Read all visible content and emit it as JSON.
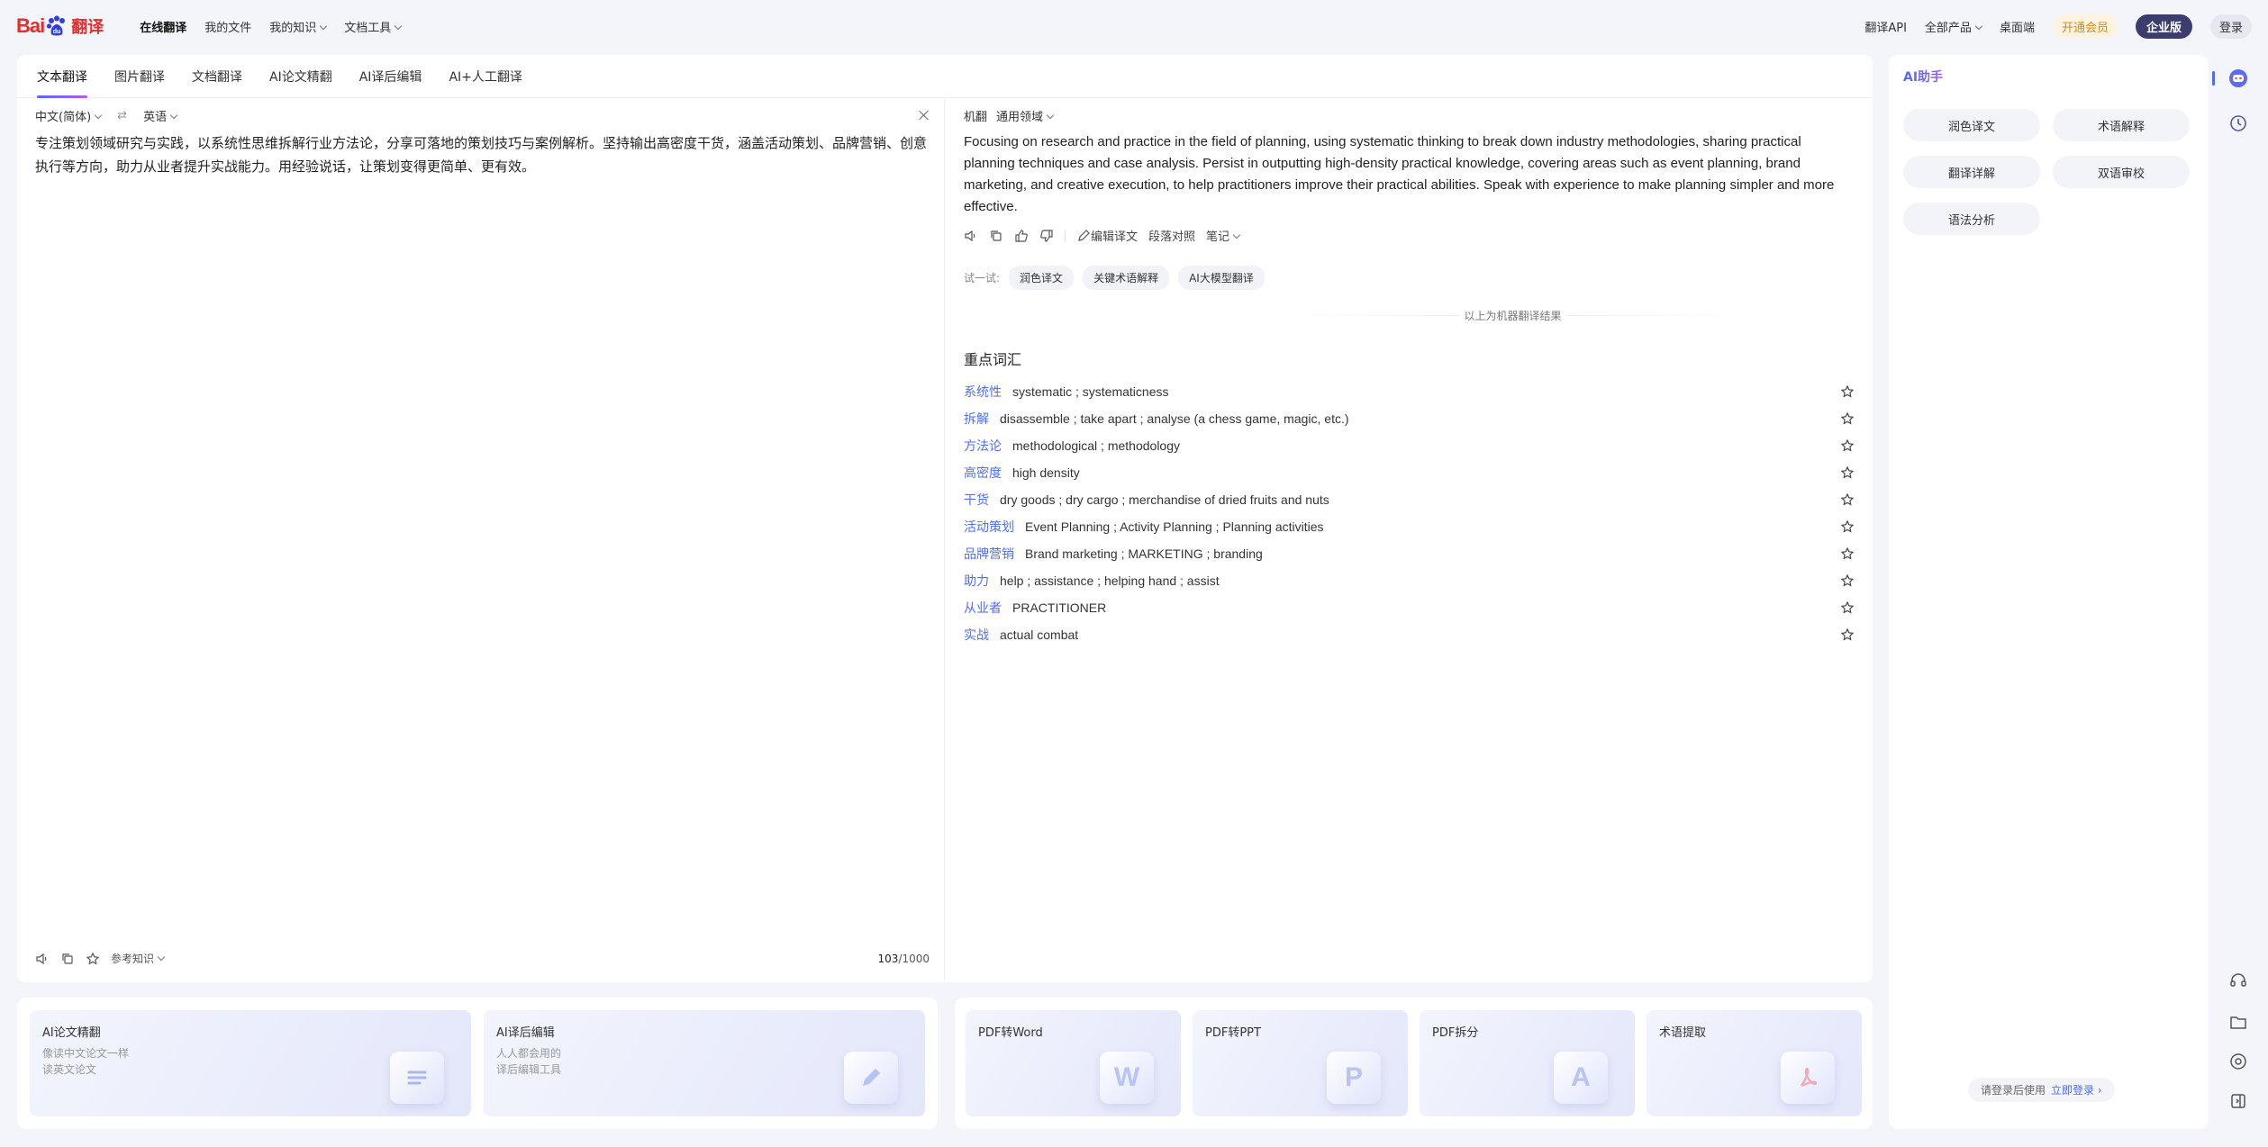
{
  "brand": {
    "logo_text": "Bai",
    "logo_suffix": "翻译"
  },
  "nav": {
    "online_translate": "在线翻译",
    "my_files": "我的文件",
    "my_knowledge": "我的知识",
    "doc_tools": "文档工具",
    "api": "翻译API",
    "all_products": "全部产品",
    "desktop": "桌面端",
    "vip": "开通会员",
    "enterprise": "企业版",
    "login": "登录"
  },
  "tabs": [
    "文本翻译",
    "图片翻译",
    "文档翻译",
    "AI论文精翻",
    "AI译后编辑",
    "AI+人工翻译"
  ],
  "source": {
    "lang_from": "中文(简体)",
    "lang_to": "英语",
    "text": "专注策划领域研究与实践，以系统性思维拆解行业方法论，分享可落地的策划技巧与案例解析。坚持输出高密度干货，涵盖活动策划、品牌营销、创意执行等方向，助力从业者提升实战能力。用经验说话，让策划变得更简单、更有效。",
    "ref_knowledge": "参考知识",
    "count": "103",
    "count_max": "/1000"
  },
  "target": {
    "engine": "机翻",
    "domain": "通用领域",
    "text": "Focusing on research and practice in the field of planning, using systematic thinking to break down industry methodologies, sharing practical planning techniques and case analysis. Persist in outputting high-density practical knowledge, covering areas such as event planning, brand marketing, and creative execution, to help practitioners improve their practical abilities. Speak with experience to make planning simpler and more effective.",
    "edit": "编辑译文",
    "paragraph": "段落对照",
    "notes": "笔记",
    "try_label": "试一试:",
    "try_chips": [
      "润色译文",
      "关键术语解释",
      "AI大模型翻译"
    ],
    "divider": "以上为机器翻译结果",
    "keywords_title": "重点词汇",
    "keywords": [
      {
        "word": "系统性",
        "def": "systematic ; systematicness"
      },
      {
        "word": "拆解",
        "def": "disassemble ; take apart ; analyse (a chess game, magic, etc.)"
      },
      {
        "word": "方法论",
        "def": "methodological ; methodology"
      },
      {
        "word": "高密度",
        "def": "high density"
      },
      {
        "word": "干货",
        "def": "dry goods ; dry cargo ; merchandise of dried fruits and nuts"
      },
      {
        "word": "活动策划",
        "def": "Event Planning ; Activity Planning ; Planning activities"
      },
      {
        "word": "品牌营销",
        "def": "Brand marketing ; MARKETING ; branding"
      },
      {
        "word": "助力",
        "def": "help ; assistance ; helping hand ; assist"
      },
      {
        "word": "从业者",
        "def": "PRACTITIONER"
      },
      {
        "word": "实战",
        "def": "actual combat"
      }
    ]
  },
  "promo": {
    "left": [
      {
        "title": "AI论文精翻",
        "line1": "像读中文论文一样",
        "line2": "读英文论文"
      },
      {
        "title": "AI译后编辑",
        "line1": "人人都会用的",
        "line2": "译后编辑工具"
      }
    ],
    "right": [
      {
        "title": "PDF转Word",
        "glyph": "W"
      },
      {
        "title": "PDF转PPT",
        "glyph": "P"
      },
      {
        "title": "PDF拆分",
        "glyph": "A"
      },
      {
        "title": "术语提取",
        "glyph": ""
      }
    ]
  },
  "assistant": {
    "title": "AI助手",
    "buttons": [
      "润色译文",
      "术语解释",
      "翻译详解",
      "双语审校",
      "语法分析"
    ],
    "login_tip": "请登录后使用",
    "login_link": "立即登录 ›"
  }
}
